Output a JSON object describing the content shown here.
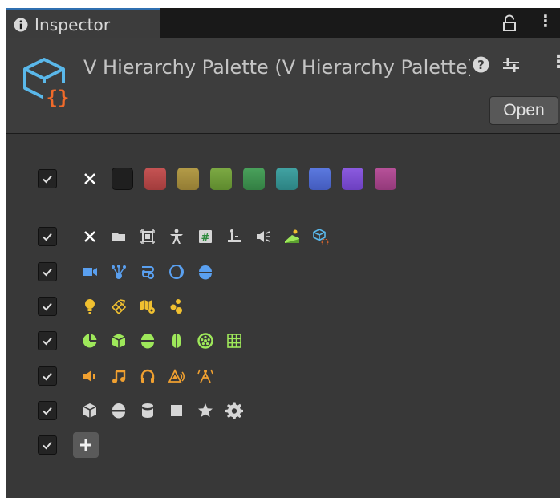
{
  "window": {
    "tab_label": "Inspector",
    "menu_glyph": "⋮"
  },
  "header": {
    "title": "V Hierarchy Palette (V Hierarchy Palette)",
    "open_button": "Open",
    "menu_glyph": "⋮"
  },
  "palette": {
    "colors": [
      {
        "name": "none",
        "hex": "#ffffff"
      },
      {
        "name": "black",
        "hex": "#1f1f1f"
      },
      {
        "name": "red",
        "hex": "#b94a4a"
      },
      {
        "name": "yellow",
        "hex": "#a7903f"
      },
      {
        "name": "lime",
        "hex": "#6f9a39"
      },
      {
        "name": "green",
        "hex": "#3f9450"
      },
      {
        "name": "teal",
        "hex": "#379595"
      },
      {
        "name": "blue",
        "hex": "#4f6bd0"
      },
      {
        "name": "violet",
        "hex": "#7e4fd3"
      },
      {
        "name": "magenta",
        "hex": "#a8458a"
      }
    ],
    "icon_rows": [
      [
        "cross-icon",
        "folder-icon",
        "rect-transform-icon",
        "humanoid-icon",
        "script-icon",
        "terrain-icon",
        "audio-source-icon",
        "landscape-icon",
        "palette-icon"
      ],
      [
        "camera-icon",
        "particle-system-icon",
        "animator-icon",
        "light-probe-icon",
        "reflection-probe-icon"
      ],
      [
        "light-icon",
        "navmesh-icon",
        "tilemap-icon",
        "spheres-icon"
      ],
      [
        "pie-collider-icon",
        "box-collider-icon",
        "sphere-collider-icon",
        "capsule-collider-icon",
        "wheel-collider-icon",
        "grid-icon"
      ],
      [
        "audio-source-speaker-icon",
        "music-note-icon",
        "headphones-icon",
        "audio-reverb-icon",
        "audio-chorus-icon"
      ],
      [
        "cube-icon",
        "sphere-icon",
        "cylinder-icon",
        "square-icon",
        "star-icon",
        "gear-icon"
      ]
    ],
    "icon_colors": {
      "gray": "#d6d6d6",
      "blue": "#5aa0f0",
      "yellow": "#f0c030",
      "green": "#9ee85a",
      "orange": "#f0a030"
    }
  }
}
